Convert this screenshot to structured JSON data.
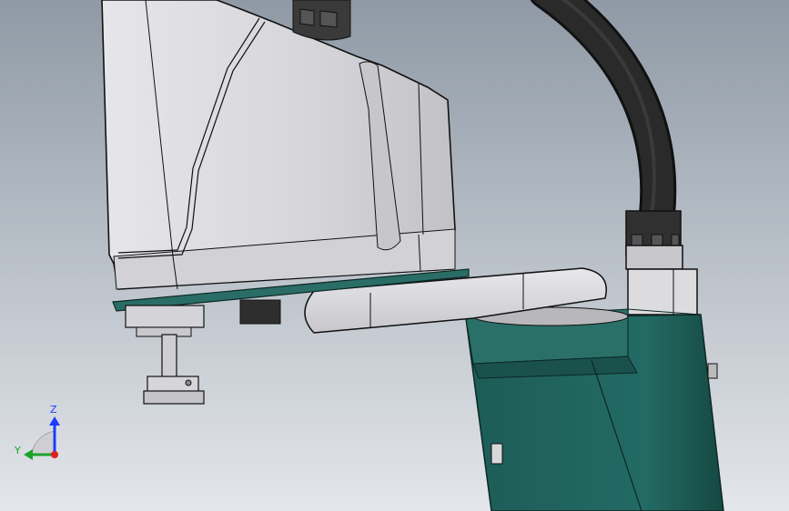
{
  "viewport": {
    "background_top": "#8f9aa6",
    "background_bottom": "#e3e6ea",
    "model_colors": {
      "housing": "#d9d8dc",
      "housing_shade": "#bfbec3",
      "edge": "#1a1a1a",
      "teal": "#1f5f5a",
      "teal_dark": "#123f3b",
      "cable": "#1c1c1c"
    }
  },
  "triad": {
    "z_label": "Z",
    "y_label": "Y",
    "z_color": "#1c3cff",
    "y_color": "#1aa32a",
    "x_color": "#e0201a"
  }
}
